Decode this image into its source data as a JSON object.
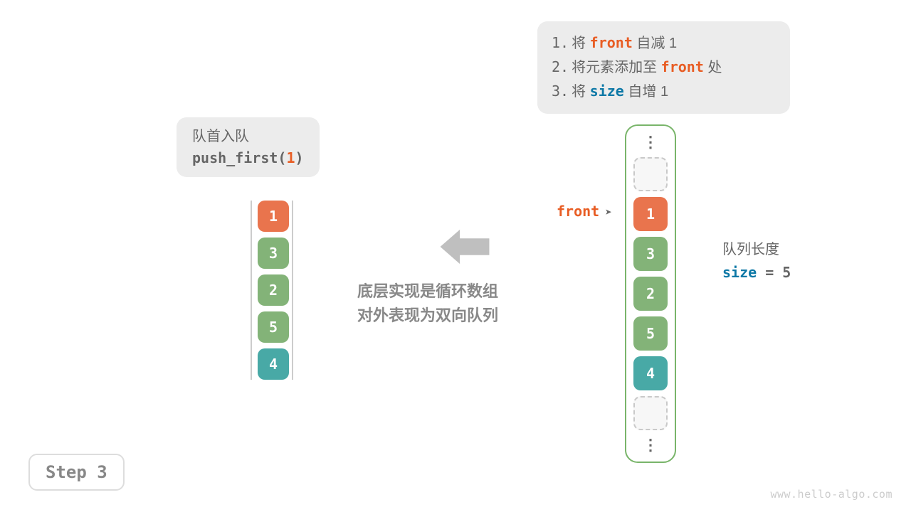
{
  "steps": [
    {
      "num": "1.",
      "pre": "将 ",
      "kw": "front",
      "kwclass": "orange",
      "post": " 自减 1"
    },
    {
      "num": "2.",
      "pre": "将元素添加至 ",
      "kw": "front",
      "kwclass": "orange",
      "post": " 处"
    },
    {
      "num": "3.",
      "pre": "将 ",
      "kw": "size",
      "kwclass": "blue",
      "post": " 自增 1"
    }
  ],
  "push_box": {
    "line1": "队首入队",
    "fn": "push_first(",
    "arg": "1",
    "close": ")"
  },
  "deque": [
    {
      "val": "1",
      "cls": "c-orange"
    },
    {
      "val": "3",
      "cls": "c-green"
    },
    {
      "val": "2",
      "cls": "c-green"
    },
    {
      "val": "5",
      "cls": "c-green"
    },
    {
      "val": "4",
      "cls": "c-teal"
    }
  ],
  "array": [
    {
      "type": "dots"
    },
    {
      "type": "empty"
    },
    {
      "type": "cell",
      "val": "1",
      "cls": "c-orange"
    },
    {
      "type": "cell",
      "val": "3",
      "cls": "c-green"
    },
    {
      "type": "cell",
      "val": "2",
      "cls": "c-green"
    },
    {
      "type": "cell",
      "val": "5",
      "cls": "c-green"
    },
    {
      "type": "cell",
      "val": "4",
      "cls": "c-teal"
    },
    {
      "type": "empty"
    },
    {
      "type": "dots"
    }
  ],
  "front_label": {
    "kw": "front"
  },
  "size_label": {
    "line1": "队列长度",
    "kw": "size",
    "eq": " = 5"
  },
  "center": {
    "l1": "底层实现是循环数组",
    "l2": "对外表现为双向队列"
  },
  "step_badge": "Step 3",
  "watermark": "www.hello-algo.com"
}
